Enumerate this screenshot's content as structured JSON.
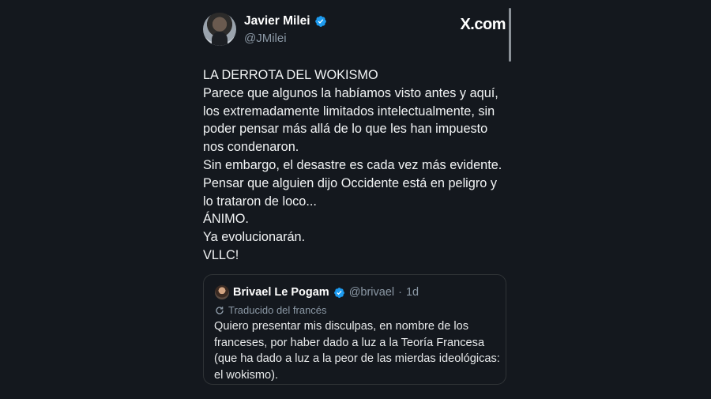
{
  "brand": "X.com",
  "author": {
    "name": "Javier Milei",
    "handle": "@JMilei"
  },
  "tweet_lines": [
    "LA DERROTA DEL WOKISMO",
    "Parece que algunos la habíamos visto antes y aquí,",
    "los extremadamente limitados intelectualmente, sin",
    "poder pensar más allá de lo que les han impuesto",
    "nos condenaron.",
    "Sin embargo, el desastre es cada vez más evidente.",
    "Pensar que alguien dijo Occidente está en peligro y",
    "lo trataron de loco...",
    "ÁNIMO.",
    "Ya evolucionarán.",
    "VLLC!"
  ],
  "quote": {
    "name": "Brivael Le Pogam",
    "handle": "@brivael",
    "time": "1d",
    "translated_label": "Traducido del francés",
    "lines": [
      "Quiero presentar mis disculpas, en nombre de los",
      "franceses, por haber dado a luz a la Teoría Francesa",
      "(que ha dado a luz a la peor de las mierdas ideológicas:",
      "el wokismo)."
    ]
  },
  "colors": {
    "background": "#14181e",
    "verified_badge": "#1d9bf0",
    "secondary_text": "#8b98a5"
  },
  "icons": [
    "verified-badge-icon",
    "translate-icon"
  ]
}
